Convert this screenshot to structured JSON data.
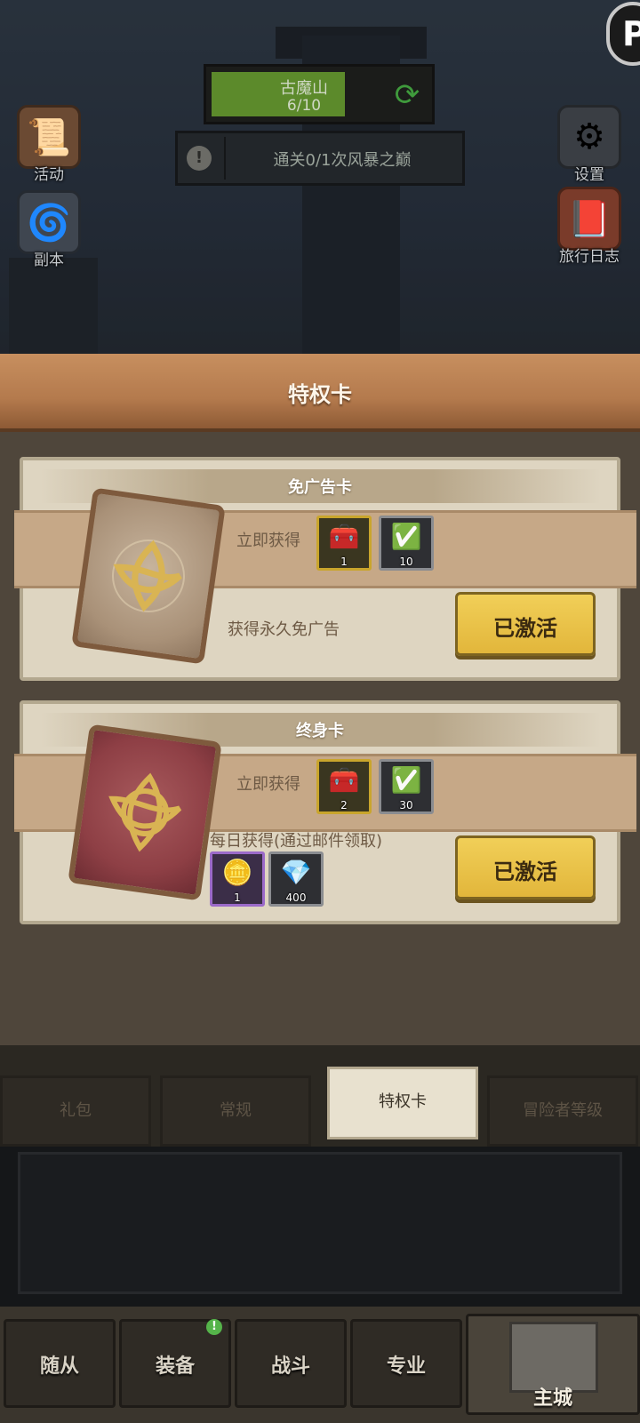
{
  "colors": {
    "accent_gold": "#e2b63b",
    "panel_header": "#b47a4d",
    "card_bg": "#ded5c1",
    "band": "#c6a887"
  },
  "hud": {
    "stage": {
      "name": "古魔山",
      "progress": "6/10",
      "icon": "refresh-icon"
    },
    "quest": {
      "text": "通关0/1次风暴之巅",
      "icon": "exclamation-icon"
    },
    "left_buttons": [
      {
        "label": "活动",
        "icon": "scroll-board-icon"
      },
      {
        "label": "副本",
        "icon": "portal-icon"
      }
    ],
    "right_buttons": [
      {
        "label": "设置",
        "icon": "gear-icon"
      },
      {
        "label": "旅行日志",
        "icon": "book-icon"
      }
    ],
    "corner_glyph": "P"
  },
  "panel": {
    "title": "特权卡"
  },
  "cards": [
    {
      "title": "免广告卡",
      "instant_label": "立即获得",
      "instant_items": [
        {
          "icon": "treasure-chest-icon",
          "count": "1",
          "frame": "gold"
        },
        {
          "icon": "checkmark-card-icon",
          "count": "10",
          "frame": "gray"
        }
      ],
      "desc": "获得永久免广告",
      "button": "已激活"
    },
    {
      "title": "终身卡",
      "instant_label": "立即获得",
      "instant_items": [
        {
          "icon": "treasure-chest-icon",
          "count": "2",
          "frame": "gold"
        },
        {
          "icon": "checkmark-card-icon",
          "count": "30",
          "frame": "gray"
        }
      ],
      "daily_label": "每日获得(通过邮件领取)",
      "daily_items": [
        {
          "icon": "gold-ore-icon",
          "count": "1",
          "frame": "purple"
        },
        {
          "icon": "gem-stone-icon",
          "count": "400",
          "frame": "gray"
        }
      ],
      "button": "已激活"
    }
  ],
  "tabs": [
    {
      "label": "礼包",
      "active": false
    },
    {
      "label": "常规",
      "active": false
    },
    {
      "label": "特权卡",
      "active": true
    },
    {
      "label": "冒险者等级",
      "active": false
    }
  ],
  "bottom_nav": [
    {
      "label": "随从"
    },
    {
      "label": "装备",
      "badge": "!"
    },
    {
      "label": "战斗"
    },
    {
      "label": "专业"
    },
    {
      "label": "主城",
      "icon": "castle-icon"
    }
  ]
}
